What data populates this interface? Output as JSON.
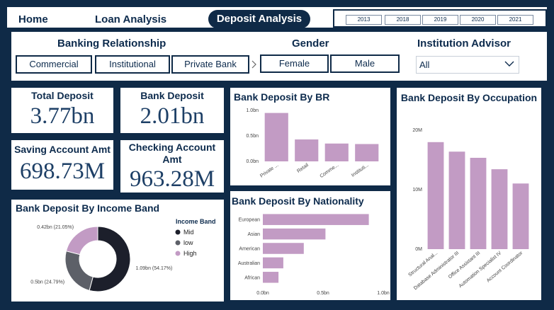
{
  "nav": {
    "home": "Home",
    "loan": "Loan Analysis",
    "deposit": "Deposit Analysis"
  },
  "years": [
    "2013",
    "2018",
    "2019",
    "2020",
    "2021"
  ],
  "filters": {
    "banking_relationship": {
      "title": "Banking Relationship",
      "options": [
        "Commercial",
        "Institutional",
        "Private Bank"
      ]
    },
    "gender": {
      "title": "Gender",
      "options": [
        "Female",
        "Male"
      ]
    },
    "advisor": {
      "title": "Institution Advisor",
      "selected": "All"
    }
  },
  "kpis": {
    "total_deposit": {
      "title": "Total Deposit",
      "value": "3.77bn"
    },
    "bank_deposit": {
      "title": "Bank Deposit",
      "value": "2.01bn"
    },
    "saving_amt": {
      "title": "Saving Account Amt",
      "value": "698.73M"
    },
    "checking_amt": {
      "title": "Checking  Account Amt",
      "value": "963.28M"
    }
  },
  "chart_data": [
    {
      "id": "by_br",
      "type": "bar",
      "title": "Bank Deposit By BR",
      "categories": [
        "Private ...",
        "Retail",
        "Comme...",
        "Instituti..."
      ],
      "values": [
        0.95,
        0.43,
        0.35,
        0.34
      ],
      "yticks": [
        "0.0bn",
        "0.5bn",
        "1.0bn"
      ],
      "ylim": [
        0,
        1.0
      ],
      "color": "#c29bc4"
    },
    {
      "id": "by_occupation",
      "type": "bar",
      "title": "Bank Deposit By Occupation",
      "categories": [
        "Structural Anal...",
        "Database Administrator III",
        "Office Assistant III",
        "Automation Specialist IV",
        "Account Coordinator"
      ],
      "values": [
        22.5,
        20.5,
        19.2,
        16.8,
        13.8
      ],
      "yticks": [
        "0M",
        "10M",
        "20M"
      ],
      "ylim": [
        0,
        25
      ],
      "color": "#c29bc4"
    },
    {
      "id": "by_nationality",
      "type": "bar",
      "orientation": "horizontal",
      "title": "Bank Deposit By Nationality",
      "categories": [
        "European",
        "Asian",
        "American",
        "Australian",
        "African"
      ],
      "values": [
        0.88,
        0.52,
        0.34,
        0.17,
        0.13
      ],
      "xticks": [
        "0.0bn",
        "0.5bn",
        "1.0bn"
      ],
      "xlim": [
        0,
        1.0
      ],
      "color": "#c29bc4"
    },
    {
      "id": "by_income_band",
      "type": "pie",
      "title": "Bank Deposit By Income Band",
      "legend_title": "Income Band",
      "slices": [
        {
          "name": "Mid",
          "value": 54.17,
          "label": "1.09bn (54.17%)",
          "color": "#1c1f2b"
        },
        {
          "name": "low",
          "value": 24.79,
          "label": "0.5bn (24.79%)",
          "color": "#5d6068"
        },
        {
          "name": "High",
          "value": 21.05,
          "label": "0.42bn (21.05%)",
          "color": "#c29bc4"
        }
      ]
    }
  ]
}
